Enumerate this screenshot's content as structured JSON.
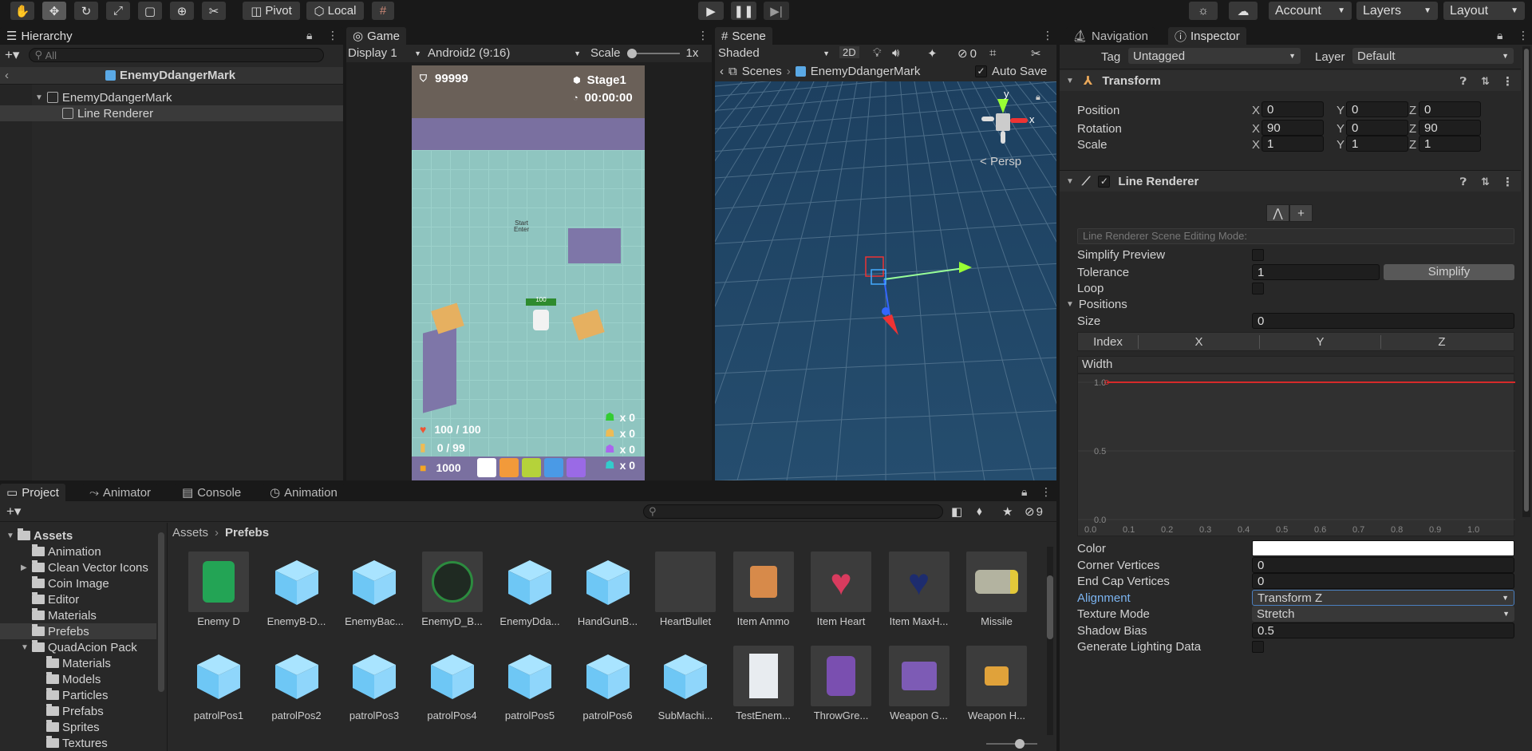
{
  "toolbar": {
    "pivot_label": "Pivot",
    "local_label": "Local",
    "account_label": "Account",
    "layers_label": "Layers",
    "layout_label": "Layout"
  },
  "hierarchy": {
    "tab_label": "Hierarchy",
    "search_placeholder": "All",
    "scene_title": "EnemyDdangerMark",
    "items": [
      {
        "label": "EnemyDdangerMark"
      },
      {
        "label": "Line Renderer"
      }
    ]
  },
  "game": {
    "tab_label": "Game",
    "display_label": "Display 1",
    "aspect_label": "Android2 (9:16)",
    "scale_label": "Scale",
    "scale_value": "1x",
    "hud": {
      "score": "99999",
      "stage": "Stage1",
      "timer": "00:00:00",
      "start_text": "Start\nEnter",
      "health": "100 / 100",
      "ammo": "0 / 99",
      "coins": "1000",
      "enemy_hp": "100",
      "counts": [
        "x 0",
        "x 0",
        "x 0",
        "x 0"
      ]
    }
  },
  "scene": {
    "tab_label": "Scene",
    "shading_label": "Shaded",
    "mode_2d": "2D",
    "hidden_count": "0",
    "breadcrumb_root": "Scenes",
    "breadcrumb_object": "EnemyDdangerMark",
    "autosave_label": "Auto Save",
    "persp_label": "Persp",
    "axis_x": "x",
    "axis_y": "y"
  },
  "inspector": {
    "tab_nav": "Navigation",
    "tab_inspector": "Inspector",
    "tag_label": "Tag",
    "tag_value": "Untagged",
    "layer_label": "Layer",
    "layer_value": "Default",
    "transform": {
      "title": "Transform",
      "rows": [
        {
          "label": "Position",
          "x": "0",
          "y": "0",
          "z": "0"
        },
        {
          "label": "Rotation",
          "x": "90",
          "y": "0",
          "z": "90"
        },
        {
          "label": "Scale",
          "x": "1",
          "y": "1",
          "z": "1"
        }
      ]
    },
    "line_renderer": {
      "title": "Line Renderer",
      "editing_mode": "Line Renderer Scene Editing Mode:",
      "simplify_preview": "Simplify Preview",
      "tolerance_label": "Tolerance",
      "tolerance_value": "1",
      "simplify_button": "Simplify",
      "loop_label": "Loop",
      "positions_label": "Positions",
      "size_label": "Size",
      "size_value": "0",
      "columns": [
        "Index",
        "X",
        "Y",
        "Z"
      ],
      "width_label": "Width",
      "curve_y_ticks": [
        "1.0",
        "0.5",
        "0.0"
      ],
      "curve_x_ticks": [
        "0.0",
        "0.1",
        "0.2",
        "0.3",
        "0.4",
        "0.5",
        "0.6",
        "0.7",
        "0.8",
        "0.9",
        "1.0"
      ],
      "color_label": "Color",
      "color_value": "#ffffff",
      "corner_label": "Corner Vertices",
      "corner_value": "0",
      "endcap_label": "End Cap Vertices",
      "endcap_value": "0",
      "alignment_label": "Alignment",
      "alignment_value": "Transform Z",
      "texture_label": "Texture Mode",
      "texture_value": "Stretch",
      "shadow_label": "Shadow Bias",
      "shadow_value": "0.5",
      "lighting_label": "Generate Lighting Data"
    }
  },
  "project": {
    "tabs": [
      "Project",
      "Animator",
      "Console",
      "Animation"
    ],
    "hidden_count": "9",
    "breadcrumb": [
      "Assets",
      "Prefebs"
    ],
    "tree": [
      {
        "label": "Assets",
        "depth": 0,
        "bold": true,
        "open": true
      },
      {
        "label": "Animation",
        "depth": 1
      },
      {
        "label": "Clean Vector Icons",
        "depth": 1,
        "arrow": true
      },
      {
        "label": "Coin Image",
        "depth": 1
      },
      {
        "label": "Editor",
        "depth": 1
      },
      {
        "label": "Materials",
        "depth": 1
      },
      {
        "label": "Prefebs",
        "depth": 1,
        "selected": true
      },
      {
        "label": "QuadAcion Pack",
        "depth": 1,
        "open": true
      },
      {
        "label": "Materials",
        "depth": 2
      },
      {
        "label": "Models",
        "depth": 2
      },
      {
        "label": "Particles",
        "depth": 2
      },
      {
        "label": "Prefabs",
        "depth": 2
      },
      {
        "label": "Sprites",
        "depth": 2
      },
      {
        "label": "Textures",
        "depth": 2
      }
    ],
    "assets": [
      {
        "label": "Enemy D",
        "kind": "green-robot"
      },
      {
        "label": "EnemyB-D...",
        "kind": "cube"
      },
      {
        "label": "EnemyBac...",
        "kind": "cube"
      },
      {
        "label": "EnemyD_B...",
        "kind": "dark-ball"
      },
      {
        "label": "EnemyDda...",
        "kind": "cube"
      },
      {
        "label": "HandGunB...",
        "kind": "cube"
      },
      {
        "label": "HeartBullet",
        "kind": "empty"
      },
      {
        "label": "Item Ammo",
        "kind": "ammo"
      },
      {
        "label": "Item Heart",
        "kind": "heart"
      },
      {
        "label": "Item MaxH...",
        "kind": "heart-dark"
      },
      {
        "label": "Missile",
        "kind": "missile"
      },
      {
        "label": "patrolPos1",
        "kind": "cube"
      },
      {
        "label": "patrolPos2",
        "kind": "cube"
      },
      {
        "label": "patrolPos3",
        "kind": "cube"
      },
      {
        "label": "patrolPos4",
        "kind": "cube"
      },
      {
        "label": "patrolPos5",
        "kind": "cube"
      },
      {
        "label": "patrolPos6",
        "kind": "cube"
      },
      {
        "label": "SubMachi...",
        "kind": "cube"
      },
      {
        "label": "TestEnem...",
        "kind": "white-box"
      },
      {
        "label": "ThrowGre...",
        "kind": "grenade"
      },
      {
        "label": "Weapon G...",
        "kind": "gun"
      },
      {
        "label": "Weapon H...",
        "kind": "hammer"
      }
    ]
  }
}
